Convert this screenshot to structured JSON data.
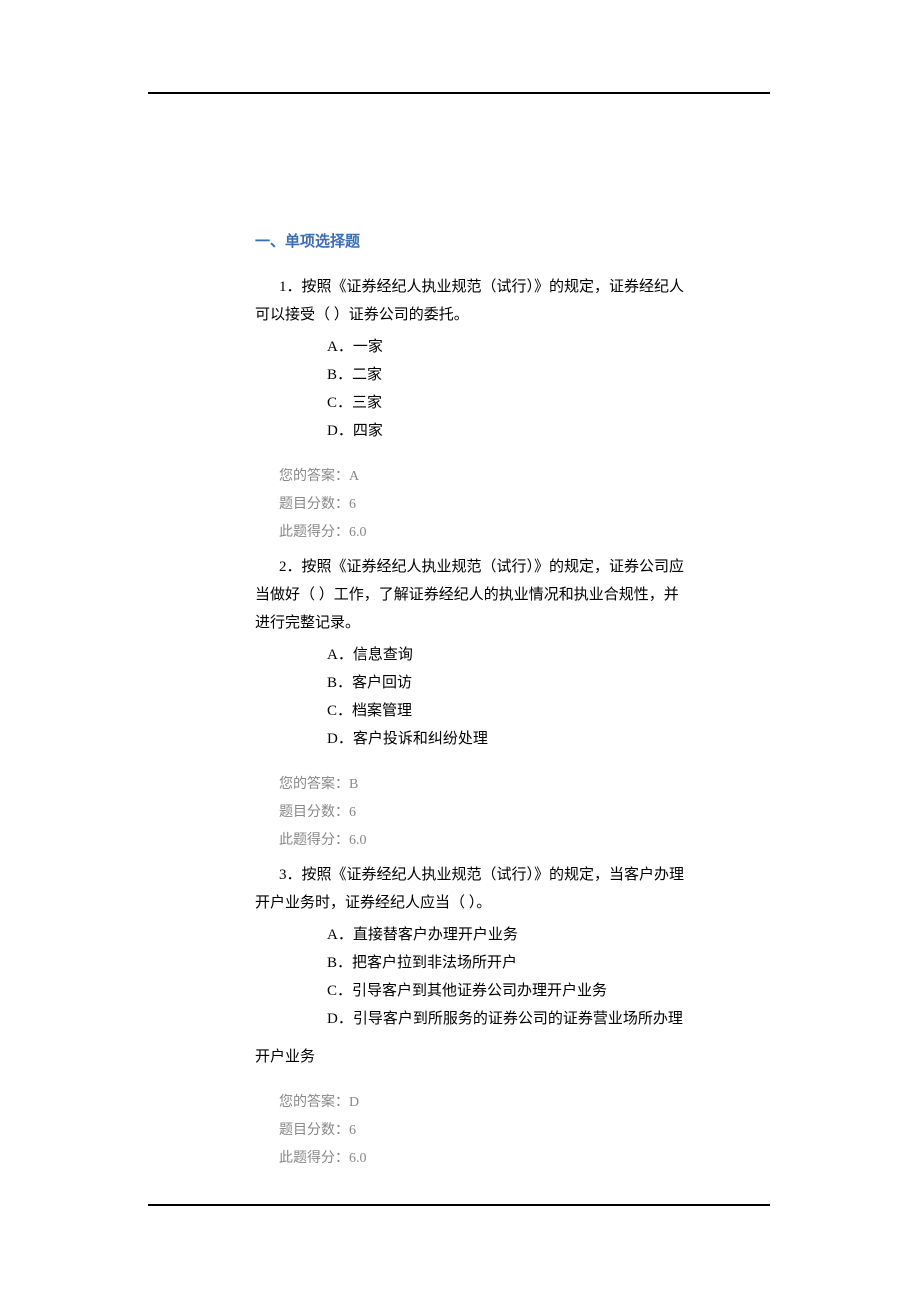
{
  "section_title": "一、单项选择题",
  "questions": [
    {
      "number": "1．",
      "text": "按照《证券经纪人执业规范（试行）》的规定，证券经纪人可以接受（ ）证券公司的委托。",
      "options": [
        {
          "label": "A．",
          "text": "一家"
        },
        {
          "label": "B．",
          "text": "二家"
        },
        {
          "label": "C．",
          "text": "三家"
        },
        {
          "label": "D．",
          "text": "四家"
        }
      ],
      "answer_label": "您的答案：",
      "answer_value": "A",
      "points_label": "题目分数：",
      "points_value": "6",
      "score_label": "此题得分：",
      "score_value": "6.0"
    },
    {
      "number": "2．",
      "text": "按照《证券经纪人执业规范（试行）》的规定，证券公司应当做好（ ）工作，了解证券经纪人的执业情况和执业合规性，并进行完整记录。",
      "options": [
        {
          "label": "A．",
          "text": "信息查询"
        },
        {
          "label": "B．",
          "text": "客户回访"
        },
        {
          "label": "C．",
          "text": "档案管理"
        },
        {
          "label": "D．",
          "text": "客户投诉和纠纷处理"
        }
      ],
      "answer_label": "您的答案：",
      "answer_value": "B",
      "points_label": "题目分数：",
      "points_value": "6",
      "score_label": "此题得分：",
      "score_value": "6.0"
    },
    {
      "number": "3．",
      "text": "按照《证券经纪人执业规范（试行）》的规定，当客户办理开户业务时，证券经纪人应当（ ）。",
      "options": [
        {
          "label": "A．",
          "text": "直接替客户办理开户业务"
        },
        {
          "label": "B．",
          "text": "把客户拉到非法场所开户"
        },
        {
          "label": "C．",
          "text": "引导客户到其他证券公司办理开户业务"
        },
        {
          "label": "D．",
          "text": "引导客户到所服务的证券公司的证券营业场所办理"
        }
      ],
      "extra_line": "开户业务",
      "answer_label": "您的答案：",
      "answer_value": "D",
      "points_label": "题目分数：",
      "points_value": "6",
      "score_label": "此题得分：",
      "score_value": "6.0"
    }
  ]
}
